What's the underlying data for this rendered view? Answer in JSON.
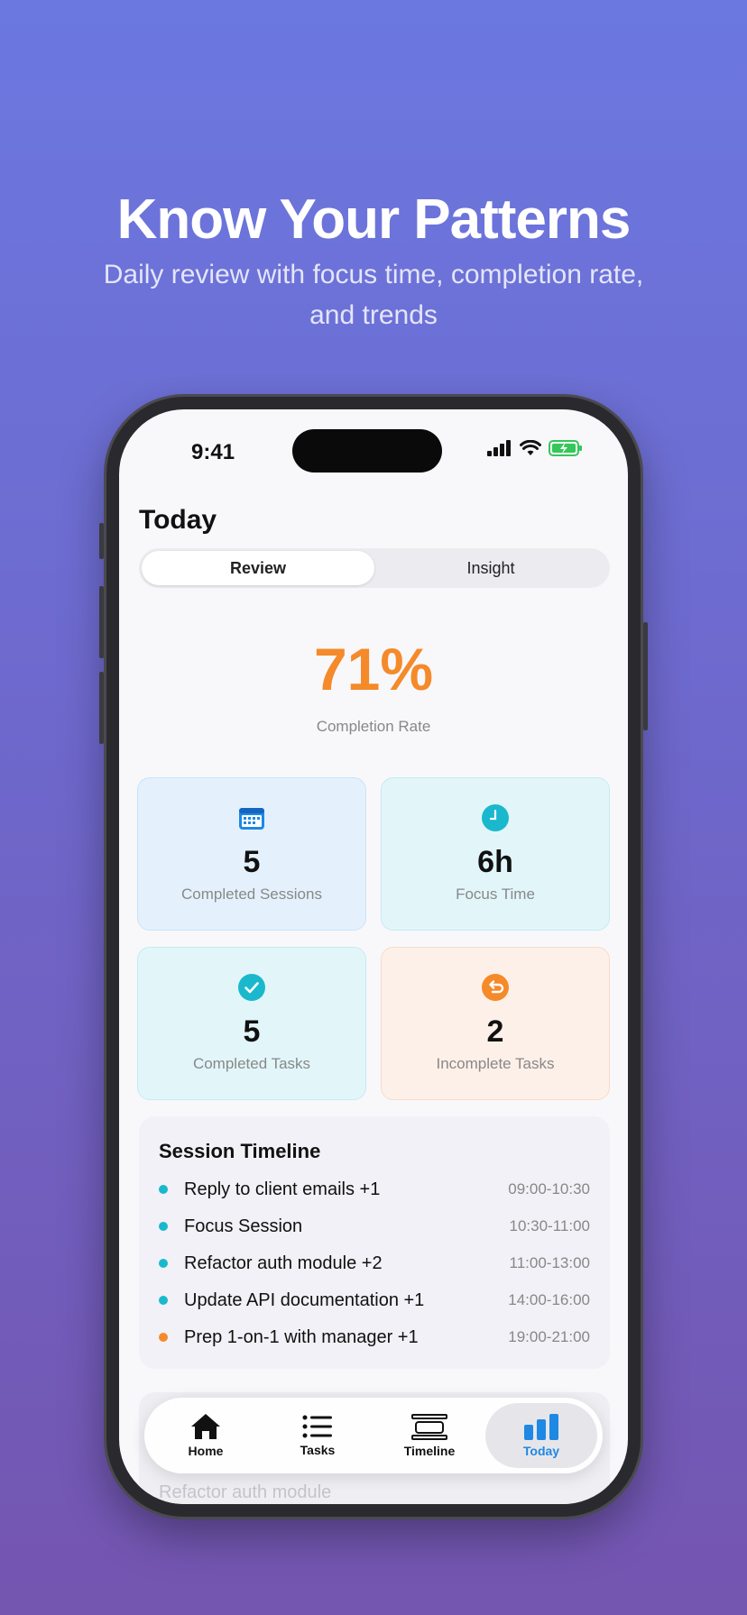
{
  "promo": {
    "title": "Know Your Patterns",
    "subtitle": "Daily review with focus time, completion rate, and trends"
  },
  "status_bar": {
    "time": "9:41",
    "icons": [
      "signal-icon",
      "wifi-icon",
      "battery-charging-icon"
    ]
  },
  "page": {
    "title": "Today"
  },
  "segmented": {
    "options": [
      "Review",
      "Insight"
    ],
    "selected": "Review"
  },
  "completion": {
    "value": "71%",
    "label": "Completion Rate"
  },
  "stats": [
    {
      "value": "5",
      "label": "Completed Sessions",
      "icon": "calendar-icon",
      "color": "#1e88e5"
    },
    {
      "value": "6h",
      "label": "Focus Time",
      "icon": "clock-icon",
      "color": "#1ab8cc"
    },
    {
      "value": "5",
      "label": "Completed Tasks",
      "icon": "checkmark-icon",
      "color": "#1ab8cc"
    },
    {
      "value": "2",
      "label": "Incomplete Tasks",
      "icon": "undo-icon",
      "color": "#f58a2a"
    }
  ],
  "timeline": {
    "title": "Session Timeline",
    "items": [
      {
        "name": "Reply to client emails +1",
        "time": "09:00-10:30",
        "color": "#1ab8cc"
      },
      {
        "name": "Focus Session",
        "time": "10:30-11:00",
        "color": "#1ab8cc"
      },
      {
        "name": "Refactor auth module +2",
        "time": "11:00-13:00",
        "color": "#1ab8cc"
      },
      {
        "name": "Update API documentation +1",
        "time": "14:00-16:00",
        "color": "#1ab8cc"
      },
      {
        "name": "Prep 1-on-1 with manager +1",
        "time": "19:00-21:00",
        "color": "#f58a2a"
      }
    ]
  },
  "behind_tabbar_text": "Refactor auth module",
  "tabbar": {
    "tabs": [
      {
        "label": "Home",
        "icon": "home-icon"
      },
      {
        "label": "Tasks",
        "icon": "list-icon"
      },
      {
        "label": "Timeline",
        "icon": "timeline-icon"
      },
      {
        "label": "Today",
        "icon": "bar-chart-icon"
      }
    ],
    "selected": "Today"
  },
  "colors": {
    "accent": "#1e88e5",
    "orange": "#f58a2a",
    "teal": "#1ab8cc"
  }
}
